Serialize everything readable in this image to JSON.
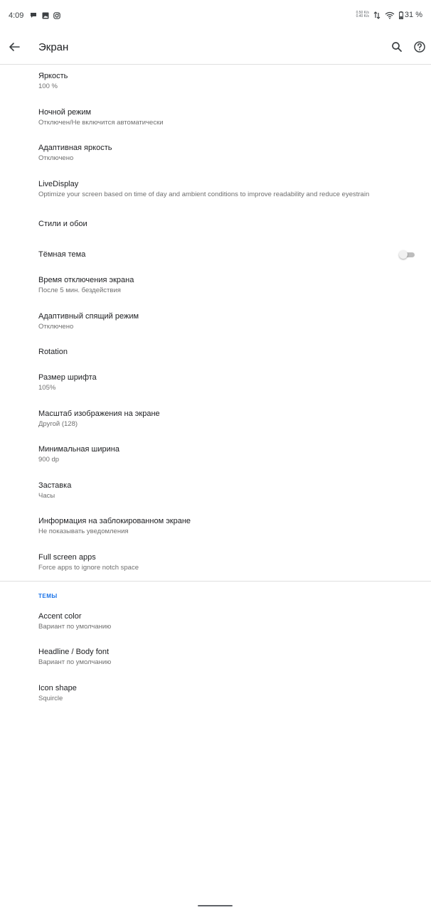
{
  "status_bar": {
    "time": "4:09",
    "net_speed_up": "0.50 K/s",
    "net_speed_down": "0.40 K/s",
    "battery": "31 %",
    "notification_icons": [
      "chat-notification-icon",
      "image-notification-icon",
      "instagram-icon"
    ]
  },
  "app_bar": {
    "title": "Экран",
    "back_icon": "arrow-back-icon",
    "search_icon": "search-icon",
    "help_icon": "help-icon"
  },
  "settings": {
    "brightness": {
      "title": "Яркость",
      "summary": "100 %"
    },
    "night_mode": {
      "title": "Ночной режим",
      "summary": "Отключен/Не включится автоматически"
    },
    "adaptive_brightness": {
      "title": "Адаптивная яркость",
      "summary": "Отключено"
    },
    "live_display": {
      "title": "LiveDisplay",
      "summary": "Optimize your screen based on time of day and ambient conditions to improve readability and reduce eyestrain"
    },
    "styles_wallpapers": {
      "title": "Стили и обои"
    },
    "dark_theme": {
      "title": "Тёмная тема",
      "enabled": false
    },
    "screen_timeout": {
      "title": "Время отключения экрана",
      "summary": "После 5 мин. бездействия"
    },
    "adaptive_sleep": {
      "title": "Адаптивный спящий режим",
      "summary": "Отключено"
    },
    "rotation": {
      "title": "Rotation"
    },
    "font_size": {
      "title": "Размер шрифта",
      "summary": "105%"
    },
    "display_size": {
      "title": "Масштаб изображения на экране",
      "summary": "Другой (128)"
    },
    "min_width": {
      "title": "Минимальная ширина",
      "summary": "900 dp"
    },
    "screensaver": {
      "title": "Заставка",
      "summary": "Часы"
    },
    "lock_screen": {
      "title": "Информация на заблокированном экране",
      "summary": "Не показывать уведомления"
    },
    "fullscreen_apps": {
      "title": "Full screen apps",
      "summary": "Force apps to ignore notch space"
    }
  },
  "themes": {
    "header": "ТЕМЫ",
    "accent_color": {
      "title": "Accent color",
      "summary": "Вариант по умолчанию"
    },
    "font": {
      "title": "Headline / Body font",
      "summary": "Вариант по умолчанию"
    },
    "icon_shape": {
      "title": "Icon shape",
      "summary": "Squircle"
    }
  },
  "colors": {
    "accent": "#1a73e8",
    "primary_text": "#202124",
    "secondary_text": "#6f6f6f",
    "divider": "#e0e0e0"
  }
}
